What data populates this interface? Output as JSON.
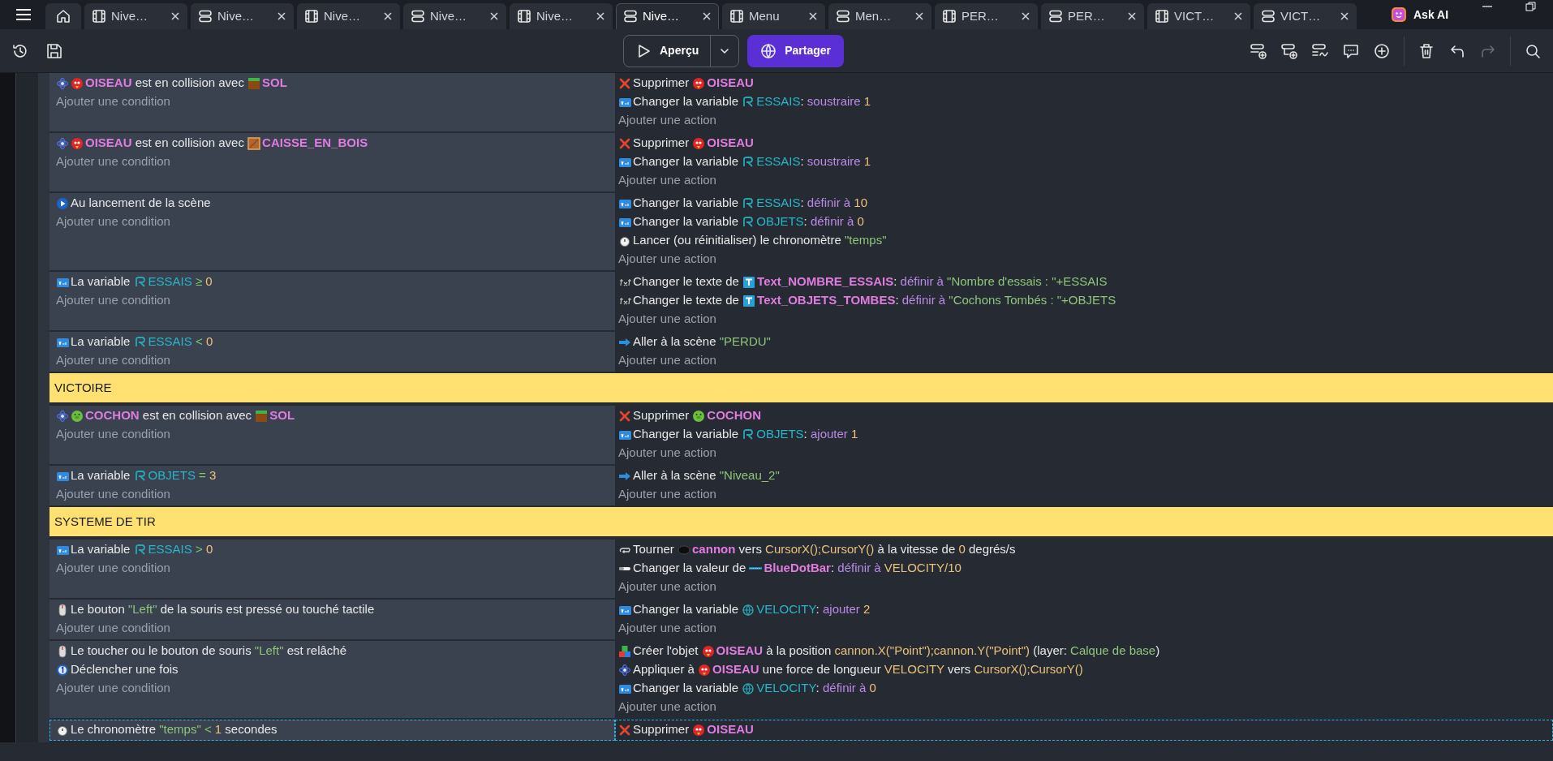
{
  "tabs": [
    {
      "kind": "scene",
      "label": "Nive…",
      "selected": false
    },
    {
      "kind": "events",
      "label": "Nive…",
      "selected": false
    },
    {
      "kind": "scene",
      "label": "Nive…",
      "selected": false
    },
    {
      "kind": "events",
      "label": "Nive…",
      "selected": false
    },
    {
      "kind": "scene",
      "label": "Nive…",
      "selected": false
    },
    {
      "kind": "events",
      "label": "Nive…",
      "selected": true
    },
    {
      "kind": "scene",
      "label": "Menu",
      "selected": false
    },
    {
      "kind": "events",
      "label": "Men…",
      "selected": false
    },
    {
      "kind": "scene",
      "label": "PER…",
      "selected": false
    },
    {
      "kind": "events",
      "label": "PER…",
      "selected": false
    },
    {
      "kind": "scene",
      "label": "VICT…",
      "selected": false
    },
    {
      "kind": "events",
      "label": "VICT…",
      "selected": false
    }
  ],
  "ask_ai": "Ask AI",
  "toolbar": {
    "preview": "Aperçu",
    "share": "Partager",
    "redo_disabled": true
  },
  "sheet": [
    {
      "kind": "event",
      "selected": false,
      "conditions": [
        [
          {
            "kind": "collision"
          },
          {
            "kind": "bird"
          },
          {
            "kind": "object",
            "text": "OISEAU"
          },
          {
            "kind": "plain",
            "text": " est en collision avec "
          },
          {
            "kind": "ground"
          },
          {
            "kind": "object",
            "text": "SOL"
          }
        ]
      ],
      "add_condition": "Ajouter une condition",
      "actions": [
        [
          {
            "kind": "delete"
          },
          {
            "kind": "plain",
            "text": "Supprimer "
          },
          {
            "kind": "bird"
          },
          {
            "kind": "object",
            "text": "OISEAU"
          }
        ],
        [
          {
            "kind": "var-op"
          },
          {
            "kind": "plain",
            "text": "Changer la variable "
          },
          {
            "kind": "scene-var"
          },
          {
            "kind": "variable",
            "text": "ESSAIS"
          },
          {
            "kind": "plain",
            "text": ": "
          },
          {
            "kind": "param",
            "text": "soustraire "
          },
          {
            "kind": "number",
            "text": "1"
          }
        ]
      ],
      "add_action": "Ajouter une action"
    },
    {
      "kind": "event",
      "selected": false,
      "conditions": [
        [
          {
            "kind": "collision"
          },
          {
            "kind": "bird"
          },
          {
            "kind": "object",
            "text": "OISEAU"
          },
          {
            "kind": "plain",
            "text": " est en collision avec "
          },
          {
            "kind": "crate"
          },
          {
            "kind": "object",
            "text": "CAISSE_EN_BOIS"
          }
        ]
      ],
      "add_condition": "Ajouter une condition",
      "actions": [
        [
          {
            "kind": "delete"
          },
          {
            "kind": "plain",
            "text": "Supprimer "
          },
          {
            "kind": "bird"
          },
          {
            "kind": "object",
            "text": "OISEAU"
          }
        ],
        [
          {
            "kind": "var-op"
          },
          {
            "kind": "plain",
            "text": "Changer la variable "
          },
          {
            "kind": "scene-var"
          },
          {
            "kind": "variable",
            "text": "ESSAIS"
          },
          {
            "kind": "plain",
            "text": ": "
          },
          {
            "kind": "param",
            "text": "soustraire "
          },
          {
            "kind": "number",
            "text": "1"
          }
        ]
      ],
      "add_action": "Ajouter une action"
    },
    {
      "kind": "event",
      "selected": false,
      "conditions": [
        [
          {
            "kind": "play"
          },
          {
            "kind": "plain",
            "text": "Au lancement de la scène"
          }
        ]
      ],
      "add_condition": "Ajouter une condition",
      "actions": [
        [
          {
            "kind": "var-op"
          },
          {
            "kind": "plain",
            "text": "Changer la variable "
          },
          {
            "kind": "scene-var"
          },
          {
            "kind": "variable",
            "text": "ESSAIS"
          },
          {
            "kind": "plain",
            "text": ": "
          },
          {
            "kind": "param",
            "text": "définir à "
          },
          {
            "kind": "number",
            "text": "10"
          }
        ],
        [
          {
            "kind": "var-op"
          },
          {
            "kind": "plain",
            "text": "Changer la variable "
          },
          {
            "kind": "scene-var"
          },
          {
            "kind": "variable",
            "text": "OBJETS"
          },
          {
            "kind": "plain",
            "text": ": "
          },
          {
            "kind": "param",
            "text": "définir à "
          },
          {
            "kind": "number",
            "text": "0"
          }
        ],
        [
          {
            "kind": "stopwatch"
          },
          {
            "kind": "plain",
            "text": "Lancer (ou réinitialiser) le chronomètre "
          },
          {
            "kind": "string",
            "text": "\"temps\""
          }
        ]
      ],
      "add_action": "Ajouter une action"
    },
    {
      "kind": "event",
      "selected": false,
      "conditions": [
        [
          {
            "kind": "var-op"
          },
          {
            "kind": "plain",
            "text": "La variable "
          },
          {
            "kind": "scene-var"
          },
          {
            "kind": "variable",
            "text": "ESSAIS"
          },
          {
            "kind": "operator",
            "text": " ≥ "
          },
          {
            "kind": "number",
            "text": "0"
          }
        ]
      ],
      "add_condition": "Ajouter une condition",
      "actions": [
        [
          {
            "kind": "txt"
          },
          {
            "kind": "plain",
            "text": "Changer le texte de "
          },
          {
            "kind": "text-object"
          },
          {
            "kind": "object",
            "text": "Text_NOMBRE_ESSAIS"
          },
          {
            "kind": "plain",
            "text": ": "
          },
          {
            "kind": "param",
            "text": "définir à "
          },
          {
            "kind": "string",
            "text": "\"Nombre d'essais : \"+ESSAIS"
          }
        ],
        [
          {
            "kind": "txt"
          },
          {
            "kind": "plain",
            "text": "Changer le texte de "
          },
          {
            "kind": "text-object"
          },
          {
            "kind": "object",
            "text": "Text_OBJETS_TOMBES"
          },
          {
            "kind": "plain",
            "text": ": "
          },
          {
            "kind": "param",
            "text": "définir à "
          },
          {
            "kind": "string",
            "text": "\"Cochons Tombés : \"+OBJETS"
          }
        ]
      ],
      "add_action": "Ajouter une action"
    },
    {
      "kind": "event",
      "selected": false,
      "conditions": [
        [
          {
            "kind": "var-op"
          },
          {
            "kind": "plain",
            "text": "La variable "
          },
          {
            "kind": "scene-var"
          },
          {
            "kind": "variable",
            "text": "ESSAIS"
          },
          {
            "kind": "operator",
            "text": " < "
          },
          {
            "kind": "number",
            "text": "0"
          }
        ]
      ],
      "add_condition": "Ajouter une condition",
      "actions": [
        [
          {
            "kind": "arrow"
          },
          {
            "kind": "plain",
            "text": "Aller à la scène "
          },
          {
            "kind": "string",
            "text": "\"PERDU\""
          }
        ]
      ],
      "add_action": "Ajouter une action"
    },
    {
      "kind": "group",
      "title": "VICTOIRE"
    },
    {
      "kind": "event",
      "selected": false,
      "conditions": [
        [
          {
            "kind": "collision"
          },
          {
            "kind": "pig"
          },
          {
            "kind": "object",
            "text": "COCHON"
          },
          {
            "kind": "plain",
            "text": " est en collision avec "
          },
          {
            "kind": "ground"
          },
          {
            "kind": "object",
            "text": "SOL"
          }
        ]
      ],
      "add_condition": "Ajouter une condition",
      "actions": [
        [
          {
            "kind": "delete"
          },
          {
            "kind": "plain",
            "text": "Supprimer "
          },
          {
            "kind": "pig"
          },
          {
            "kind": "object",
            "text": "COCHON"
          }
        ],
        [
          {
            "kind": "var-op"
          },
          {
            "kind": "plain",
            "text": "Changer la variable "
          },
          {
            "kind": "scene-var"
          },
          {
            "kind": "variable",
            "text": "OBJETS"
          },
          {
            "kind": "plain",
            "text": ": "
          },
          {
            "kind": "param",
            "text": "ajouter "
          },
          {
            "kind": "number",
            "text": "1"
          }
        ]
      ],
      "add_action": "Ajouter une action"
    },
    {
      "kind": "event",
      "selected": false,
      "conditions": [
        [
          {
            "kind": "var-op"
          },
          {
            "kind": "plain",
            "text": "La variable "
          },
          {
            "kind": "scene-var"
          },
          {
            "kind": "variable",
            "text": "OBJETS"
          },
          {
            "kind": "operator",
            "text": " = "
          },
          {
            "kind": "number",
            "text": "3"
          }
        ]
      ],
      "add_condition": "Ajouter une condition",
      "actions": [
        [
          {
            "kind": "arrow"
          },
          {
            "kind": "plain",
            "text": "Aller à la scène "
          },
          {
            "kind": "string",
            "text": "\"Niveau_2\""
          }
        ]
      ],
      "add_action": "Ajouter une action"
    },
    {
      "kind": "group",
      "title": "SYSTEME DE TIR"
    },
    {
      "kind": "event",
      "selected": false,
      "conditions": [
        [
          {
            "kind": "var-op"
          },
          {
            "kind": "plain",
            "text": "La variable "
          },
          {
            "kind": "scene-var"
          },
          {
            "kind": "variable",
            "text": "ESSAIS"
          },
          {
            "kind": "operator",
            "text": " > "
          },
          {
            "kind": "number",
            "text": "0"
          }
        ]
      ],
      "add_condition": "Ajouter une condition",
      "actions": [
        [
          {
            "kind": "rotate"
          },
          {
            "kind": "plain",
            "text": "Tourner "
          },
          {
            "kind": "cannon"
          },
          {
            "kind": "object",
            "text": "cannon"
          },
          {
            "kind": "plain",
            "text": " vers "
          },
          {
            "kind": "expression",
            "text": "CursorX();CursorY()"
          },
          {
            "kind": "plain",
            "text": " à la vitesse de "
          },
          {
            "kind": "number",
            "text": "0"
          },
          {
            "kind": "plain",
            "text": " degrés/s"
          }
        ],
        [
          {
            "kind": "slider"
          },
          {
            "kind": "plain",
            "text": "Changer la valeur de "
          },
          {
            "kind": "bar"
          },
          {
            "kind": "object",
            "text": "BlueDotBar"
          },
          {
            "kind": "plain",
            "text": ": "
          },
          {
            "kind": "param",
            "text": "définir à "
          },
          {
            "kind": "expression",
            "text": "VELOCITY/10"
          }
        ]
      ],
      "add_action": "Ajouter une action"
    },
    {
      "kind": "event",
      "selected": false,
      "conditions": [
        [
          {
            "kind": "mouse"
          },
          {
            "kind": "plain",
            "text": "Le bouton "
          },
          {
            "kind": "string",
            "text": "\"Left\""
          },
          {
            "kind": "plain",
            "text": " de la souris est pressé ou touché tactile"
          }
        ]
      ],
      "add_condition": "Ajouter une condition",
      "actions": [
        [
          {
            "kind": "var-op"
          },
          {
            "kind": "plain",
            "text": "Changer la variable "
          },
          {
            "kind": "global-var"
          },
          {
            "kind": "variable",
            "text": "VELOCITY"
          },
          {
            "kind": "plain",
            "text": ": "
          },
          {
            "kind": "param",
            "text": "ajouter "
          },
          {
            "kind": "number",
            "text": "2"
          }
        ]
      ],
      "add_action": "Ajouter une action"
    },
    {
      "kind": "event",
      "selected": false,
      "conditions": [
        [
          {
            "kind": "mouse"
          },
          {
            "kind": "plain",
            "text": "Le toucher ou le bouton de souris "
          },
          {
            "kind": "string",
            "text": "\"Left\""
          },
          {
            "kind": "plain",
            "text": " est relâché"
          }
        ],
        [
          {
            "kind": "once"
          },
          {
            "kind": "plain",
            "text": "Déclencher une fois"
          }
        ]
      ],
      "add_condition": "Ajouter une condition",
      "actions": [
        [
          {
            "kind": "create"
          },
          {
            "kind": "plain",
            "text": "Créer l'objet "
          },
          {
            "kind": "bird"
          },
          {
            "kind": "object",
            "text": "OISEAU"
          },
          {
            "kind": "plain",
            "text": " à la position "
          },
          {
            "kind": "expression",
            "text": "cannon.X(\"Point\");cannon.Y(\"Point\")"
          },
          {
            "kind": "plain",
            "text": " (layer: "
          },
          {
            "kind": "string",
            "text": "Calque de base"
          },
          {
            "kind": "plain",
            "text": ")"
          }
        ],
        [
          {
            "kind": "collision"
          },
          {
            "kind": "plain",
            "text": "Appliquer à "
          },
          {
            "kind": "bird"
          },
          {
            "kind": "object",
            "text": "OISEAU"
          },
          {
            "kind": "plain",
            "text": " une force de longueur "
          },
          {
            "kind": "expression",
            "text": "VELOCITY"
          },
          {
            "kind": "plain",
            "text": " vers "
          },
          {
            "kind": "expression",
            "text": "CursorX();CursorY()"
          }
        ],
        [
          {
            "kind": "var-op"
          },
          {
            "kind": "plain",
            "text": "Changer la variable "
          },
          {
            "kind": "global-var"
          },
          {
            "kind": "variable",
            "text": "VELOCITY"
          },
          {
            "kind": "plain",
            "text": ": "
          },
          {
            "kind": "param",
            "text": "définir à "
          },
          {
            "kind": "number",
            "text": "0"
          }
        ]
      ],
      "add_action": "Ajouter une action"
    },
    {
      "kind": "event",
      "selected": true,
      "conditions": [
        [
          {
            "kind": "stopwatch"
          },
          {
            "kind": "plain",
            "text": "Le chronomètre "
          },
          {
            "kind": "string",
            "text": "\"temps\""
          },
          {
            "kind": "operator",
            "text": " < "
          },
          {
            "kind": "number",
            "text": "1"
          },
          {
            "kind": "plain",
            "text": " secondes"
          }
        ]
      ],
      "actions": [
        [
          {
            "kind": "delete"
          },
          {
            "kind": "plain",
            "text": "Supprimer "
          },
          {
            "kind": "bird"
          },
          {
            "kind": "object",
            "text": "OISEAU"
          }
        ]
      ]
    }
  ]
}
